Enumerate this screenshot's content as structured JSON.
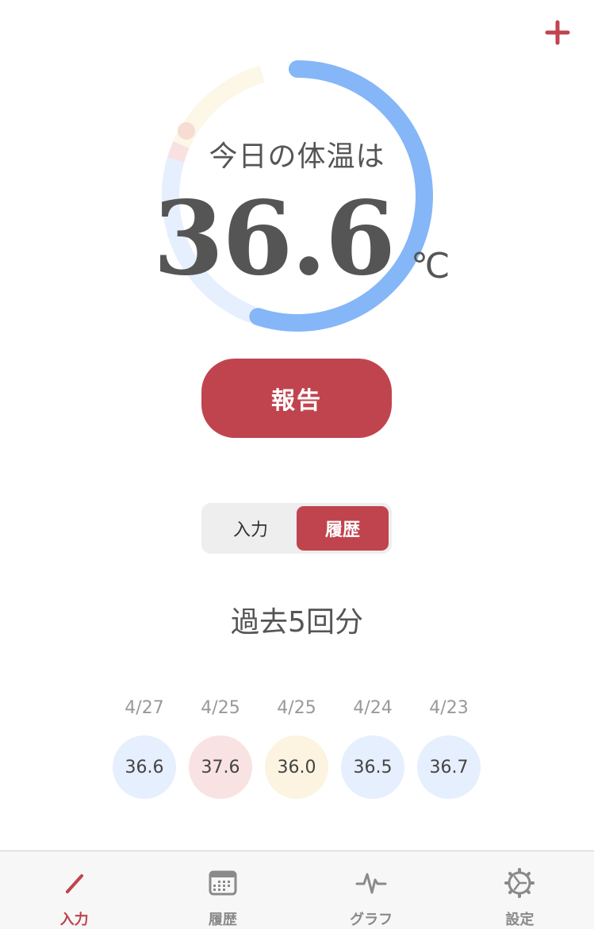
{
  "header": {
    "add_icon": "plus-icon",
    "accent_color": "#c0444e"
  },
  "today": {
    "label": "今日の体温は",
    "value": "36.6",
    "unit": "℃",
    "gauge_fraction": 0.55
  },
  "report_button": {
    "label": "報告"
  },
  "segmented": {
    "options": [
      {
        "label": "入力",
        "active": false
      },
      {
        "label": "履歴",
        "active": true
      }
    ]
  },
  "history": {
    "title": "過去5回分",
    "items": [
      {
        "date": "4/27",
        "value": "36.6",
        "color": "#e6effd"
      },
      {
        "date": "4/25",
        "value": "37.6",
        "color": "#f9e2e2"
      },
      {
        "date": "4/25",
        "value": "36.0",
        "color": "#fcf4e0"
      },
      {
        "date": "4/24",
        "value": "36.5",
        "color": "#e6effd"
      },
      {
        "date": "4/23",
        "value": "36.7",
        "color": "#e6effd"
      }
    ]
  },
  "tabbar": {
    "tabs": [
      {
        "label": "入力",
        "icon": "pencil-icon",
        "active": true
      },
      {
        "label": "履歴",
        "icon": "calendar-icon",
        "active": false
      },
      {
        "label": "グラフ",
        "icon": "pulse-icon",
        "active": false
      },
      {
        "label": "設定",
        "icon": "gear-icon",
        "active": false
      }
    ]
  }
}
